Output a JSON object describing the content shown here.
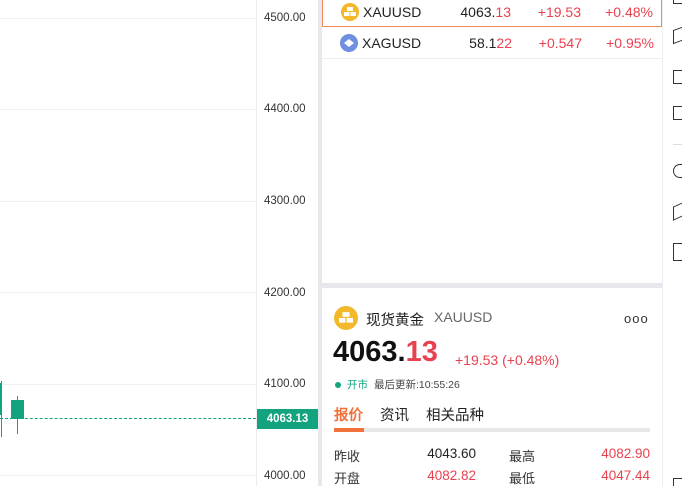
{
  "axis": {
    "labels": [
      "4500.00",
      "4400.00",
      "4300.00",
      "4200.00",
      "4100.00",
      "4000.00"
    ],
    "current_price_tag": "4063.13"
  },
  "watchlist": [
    {
      "symbol": "XAUUSD",
      "price_main": "4063.",
      "price_tail": "13",
      "change": "+19.53",
      "percent": "+0.48%",
      "icon": "gold-bars-icon",
      "selected": true
    },
    {
      "symbol": "XAGUSD",
      "price_main": "58.1",
      "price_tail": "22",
      "change": "+0.547",
      "percent": "+0.95%",
      "icon": "silver-icon",
      "selected": false
    }
  ],
  "quote": {
    "name": "现货黄金",
    "code": "XAUUSD",
    "more": "ooo",
    "price_main": "4063.",
    "price_tail": "13",
    "change": "+19.53 (+0.48%)",
    "market_status": "开市",
    "last_update": "最后更新:10:55:26",
    "tabs": [
      "报价",
      "资讯",
      "相关品种"
    ],
    "stats": [
      {
        "label": "昨收",
        "value": "4043.60",
        "tone": "neutral"
      },
      {
        "label": "最高",
        "value": "4082.90",
        "tone": "up"
      },
      {
        "label": "开盘",
        "value": "4082.82",
        "tone": "up"
      },
      {
        "label": "最低",
        "value": "4047.44",
        "tone": "up"
      }
    ]
  },
  "colors": {
    "up": "#e8414f",
    "green": "#14a37f",
    "accent": "#f0713a"
  }
}
